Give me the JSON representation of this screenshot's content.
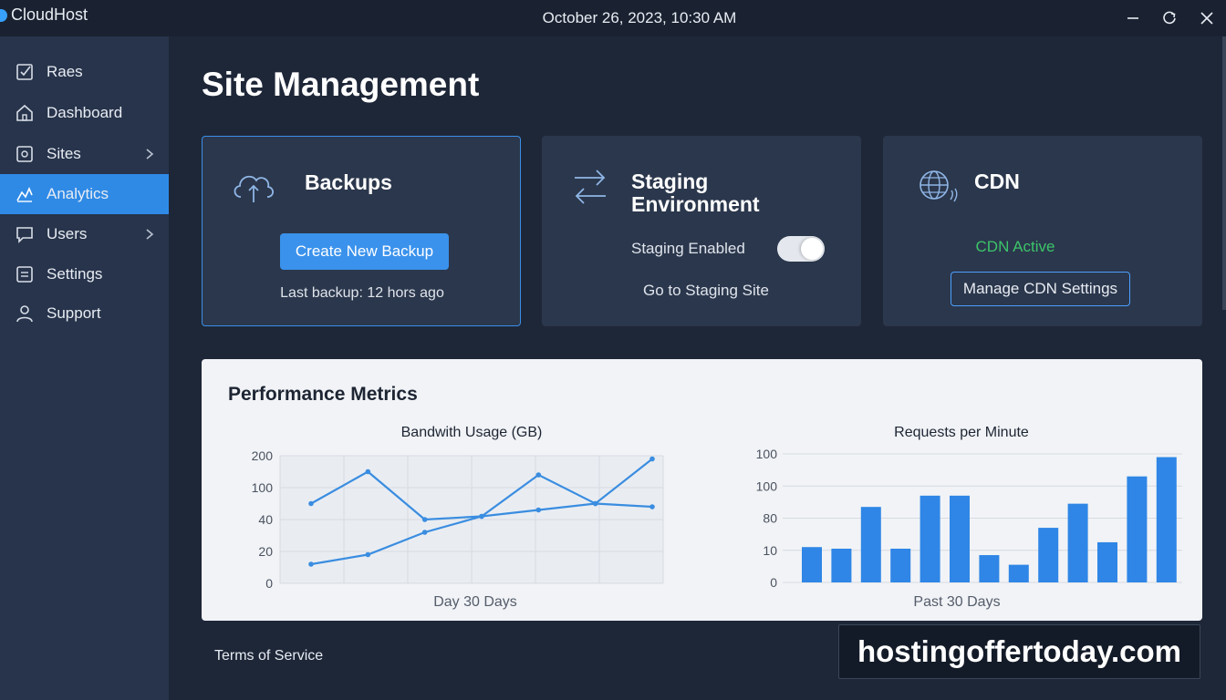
{
  "app": {
    "title": "CloudHost",
    "datetime": "October 26, 2023, 10:30 AM"
  },
  "window_controls": [
    "minimize-icon",
    "restore-icon",
    "close-icon"
  ],
  "sidebar": {
    "items": [
      {
        "label": "Raes",
        "icon": "checklist-icon",
        "active": false,
        "has_submenu": false
      },
      {
        "label": "Dashboard",
        "icon": "home-icon",
        "active": false,
        "has_submenu": false
      },
      {
        "label": "Sites",
        "icon": "site-icon",
        "active": false,
        "has_submenu": true
      },
      {
        "label": "Analytics",
        "icon": "analytics-icon",
        "active": true,
        "has_submenu": false
      },
      {
        "label": "Users",
        "icon": "chat-icon",
        "active": false,
        "has_submenu": true
      },
      {
        "label": "Settings",
        "icon": "settings-icon",
        "active": false,
        "has_submenu": false
      },
      {
        "label": "Support",
        "icon": "user-icon",
        "active": false,
        "has_submenu": false
      }
    ]
  },
  "main": {
    "title": "Site Management",
    "cards": {
      "backups": {
        "title": "Backups",
        "button": "Create New Backup",
        "status": "Last backup: 12 hors ago"
      },
      "staging": {
        "title_line1": "Staging",
        "title_line2": "Environment",
        "toggle_label": "Staging Enabled",
        "toggle_on": true,
        "link": "Go to Staging Site"
      },
      "cdn": {
        "title": "CDN",
        "status": "CDN Active",
        "button": "Manage CDN Settings"
      }
    }
  },
  "performance": {
    "title": "Performance Metrics"
  },
  "chart_data": [
    {
      "type": "line",
      "title": "Bandwith Usage (GB)",
      "xlabel": "Day 30 Days",
      "ylabel": "",
      "ytick_labels": [
        "0",
        "20",
        "40",
        "100",
        "200"
      ],
      "x": [
        1,
        2,
        3,
        4,
        5,
        6,
        7
      ],
      "series": [
        {
          "values_tick_index": [
            2.5,
            3.5,
            2.0,
            2.1,
            3.4,
            2.5,
            3.9
          ]
        },
        {
          "values_tick_index": [
            0.6,
            0.9,
            1.6,
            2.1,
            2.3,
            2.5,
            2.4
          ]
        }
      ],
      "grid": true,
      "color": "#3a8de0"
    },
    {
      "type": "bar",
      "title": "Requests per Minute",
      "xlabel": "Past 30 Days",
      "ylabel": "",
      "ytick_labels": [
        "0",
        "10",
        "80",
        "100",
        "100"
      ],
      "categories": [
        "1",
        "2",
        "3",
        "4",
        "5",
        "6",
        "7",
        "8",
        "9",
        "10",
        "11",
        "12",
        "13"
      ],
      "values_tick_index": [
        1.1,
        1.05,
        2.35,
        1.05,
        2.7,
        2.7,
        0.85,
        0.55,
        1.7,
        2.45,
        1.25,
        3.3,
        3.9
      ],
      "grid": false,
      "color": "#2f86e6"
    }
  ],
  "footer": {
    "terms": "Terms of Service",
    "watermark": "hostingoffertoday.com"
  }
}
